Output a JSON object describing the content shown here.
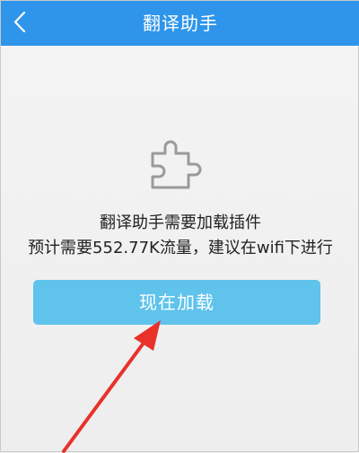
{
  "header": {
    "title": "翻译助手",
    "back_icon": "chevron-left-icon",
    "bg_color": "#2e95ea"
  },
  "content": {
    "plugin_icon": "puzzle-piece-icon",
    "message_line1": "翻译助手需要加载插件",
    "message_line2": "预计需要552.77K流量，建议在wifi下进行"
  },
  "actions": {
    "load_now_label": "现在加载",
    "load_button_color": "#5fc3ec"
  },
  "annotation": {
    "arrow_icon": "red-arrow-icon",
    "arrow_color": "#e8322a"
  }
}
